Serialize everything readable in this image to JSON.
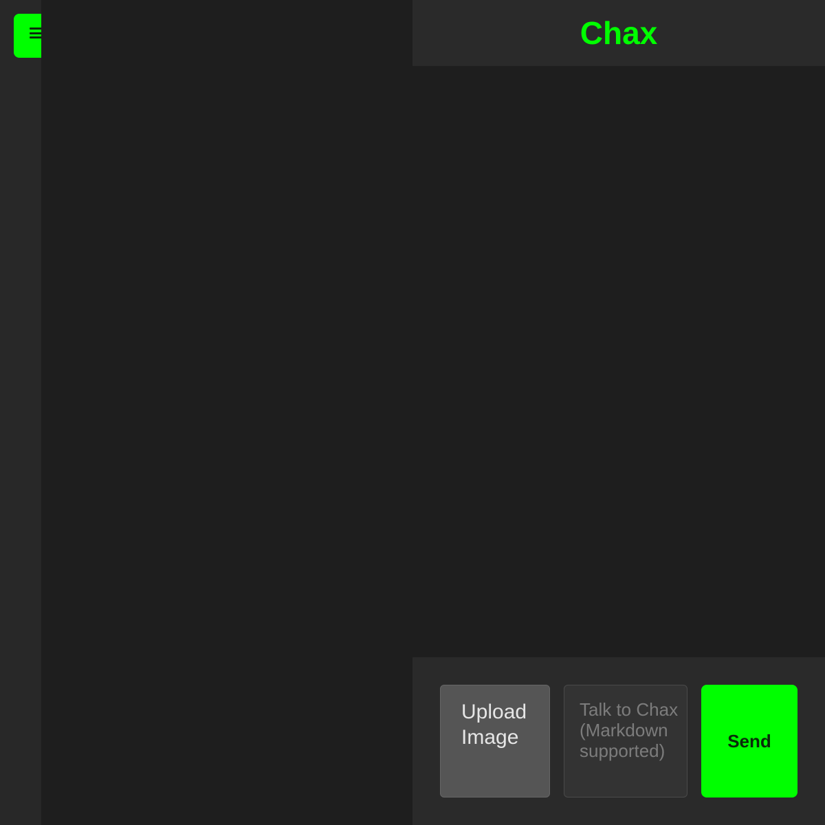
{
  "app": {
    "title": "Chax",
    "accent_color": "#00ff00"
  },
  "sidebar": {
    "menu_icon": "hamburger-menu-icon"
  },
  "composer": {
    "upload_label": "Upload Image",
    "input_placeholder": "Talk to Chax (Markdown supported)",
    "input_value": "",
    "send_label": "Send"
  }
}
